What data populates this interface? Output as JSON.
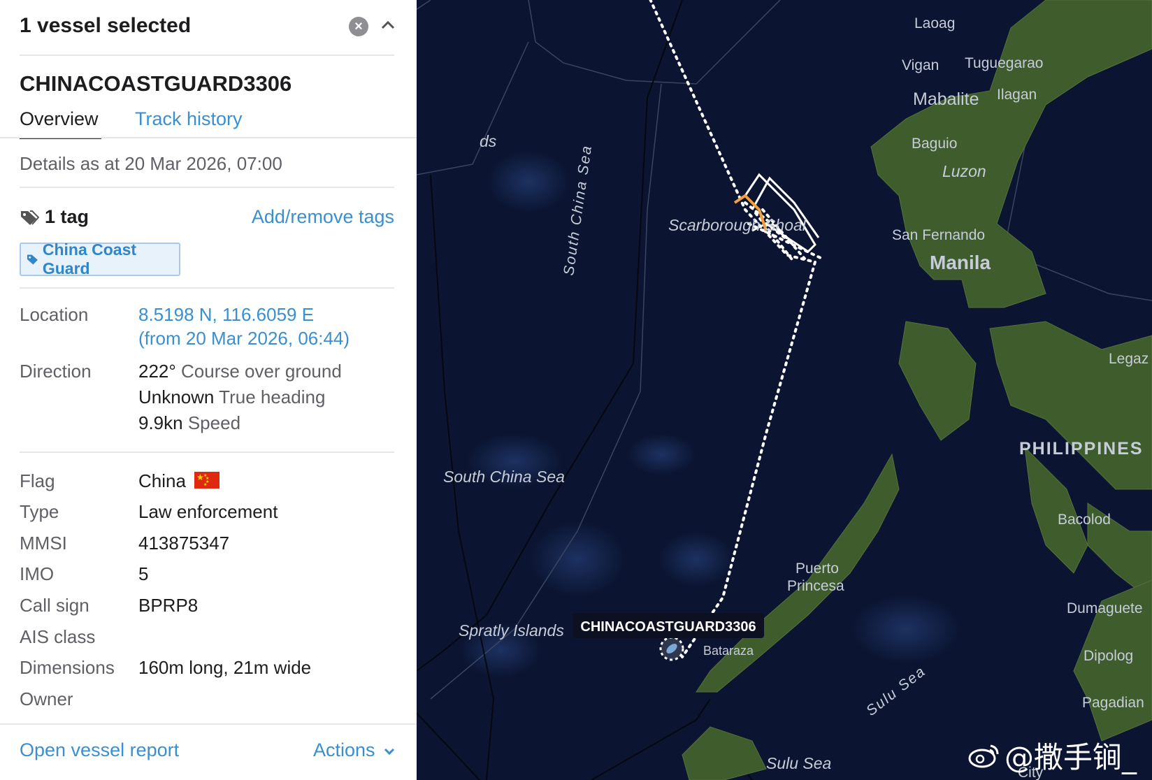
{
  "panel": {
    "header_title": "1 vessel selected",
    "vessel_name": "CHINACOASTGUARD3306",
    "tabs": [
      {
        "label": "Overview",
        "active": true
      },
      {
        "label": "Track history",
        "active": false
      }
    ],
    "details_timestamp": "Details as at 20 Mar 2026, 07:00",
    "tag_count": "1 tag",
    "add_remove_tags": "Add/remove tags",
    "tag_chip": "China Coast Guard",
    "location_label": "Location",
    "location_value": "8.5198 N, 116.6059 E",
    "location_time": "(from 20 Mar 2026, 06:44)",
    "direction_label": "Direction",
    "course_value": "222°",
    "course_label": "Course over ground",
    "heading_value": "Unknown",
    "heading_label": "True heading",
    "speed_value": "9.9kn",
    "speed_label": "Speed",
    "flag_label": "Flag",
    "flag_value": "China",
    "type_label": "Type",
    "type_value": "Law enforcement",
    "mmsi_label": "MMSI",
    "mmsi_value": "413875347",
    "imo_label": "IMO",
    "imo_value": "5",
    "callsign_label": "Call sign",
    "callsign_value": "BPRP8",
    "ais_label": "AIS class",
    "dimensions_label": "Dimensions",
    "dimensions_value": "160m long, 21m wide",
    "owner_label": "Owner",
    "open_report": "Open vessel report",
    "actions": "Actions"
  },
  "map": {
    "labels": {
      "laoag": "Laoag",
      "vigan": "Vigan",
      "tuguegarao": "Tuguegarao",
      "mabalite": "Mabalite",
      "ilagan": "Ilagan",
      "baguio": "Baguio",
      "luzon": "Luzon",
      "san_fernando": "San Fernando",
      "manila": "Manila",
      "scarborough": "Scarborough Shoal",
      "scs_vertical": "South China Sea",
      "scs_horizontal": "South China Sea",
      "spratly": "Spratly Islands",
      "puerto": "Puerto",
      "princesa": "Princesa",
      "philippines": "PHILIPPINES",
      "bacolod": "Bacolod",
      "legaz": "Legaz",
      "dumaguete": "Dumaguete",
      "dipolog": "Dipolog",
      "pagadian": "Pagadian",
      "sulu_sea_diag": "Sulu Sea",
      "sulu_sea": "Sulu Sea",
      "ds": "ds",
      "batarza": "Bataraza",
      "city": "City"
    },
    "vessel_label": "CHINACOASTGUARD3306",
    "watermark": "@撒手锏_",
    "colors": {
      "ocean": "#0b1430",
      "land": "#3d5a2c",
      "track": "#ffffff",
      "highlight": "#f0a040"
    }
  }
}
